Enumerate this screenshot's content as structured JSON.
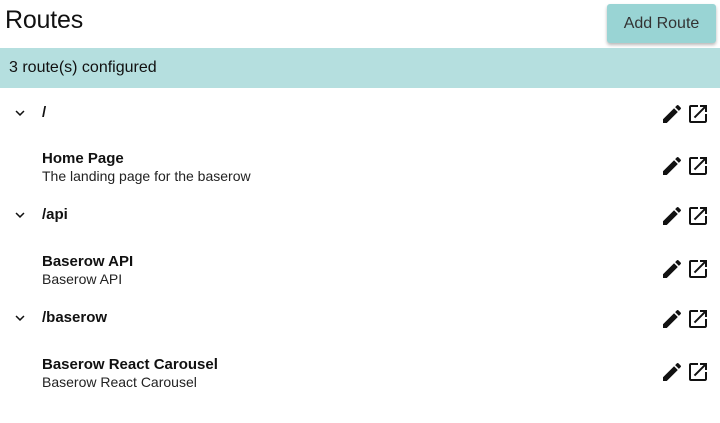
{
  "header": {
    "title": "Routes",
    "add_button_label": "Add Route"
  },
  "status": {
    "text": "3 route(s) configured"
  },
  "routes": [
    {
      "path": "/",
      "child": {
        "title": "Home Page",
        "description": "The landing page for the baserow"
      }
    },
    {
      "path": "/api",
      "child": {
        "title": "Baserow API",
        "description": "Baserow API"
      }
    },
    {
      "path": "/baserow",
      "child": {
        "title": "Baserow React Carousel",
        "description": "Baserow React Carousel"
      }
    }
  ],
  "icons": {
    "expand": "chevron-down-icon",
    "edit": "pencil-icon",
    "open": "open-in-new-icon"
  },
  "colors": {
    "accent": "#99d4d4",
    "status_bar": "#b5dfdf"
  }
}
